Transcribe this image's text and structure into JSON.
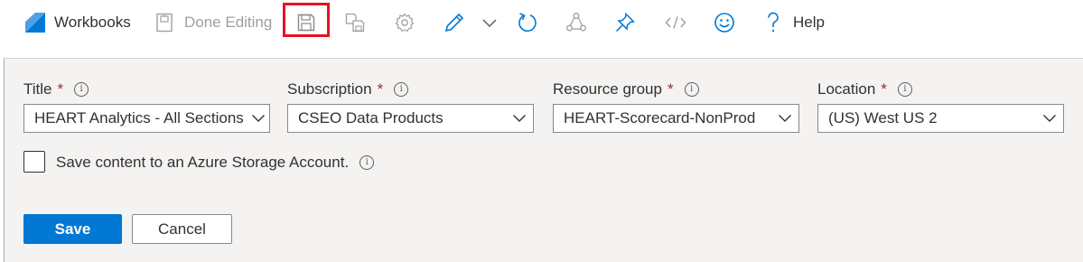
{
  "toolbar": {
    "workbooks_label": "Workbooks",
    "done_editing_label": "Done Editing",
    "help_label": "Help",
    "icons": [
      "workbooks-logo-icon",
      "done-editing-icon",
      "save-icon",
      "save-as-icon",
      "settings-icon",
      "edit-icon",
      "chevron-down-icon",
      "refresh-icon",
      "share-icon",
      "pin-icon",
      "code-icon",
      "feedback-smile-icon",
      "help-icon"
    ]
  },
  "form": {
    "title_label": "Title",
    "title_value": "HEART Analytics - All Sections",
    "subscription_label": "Subscription",
    "subscription_value": "CSEO Data Products",
    "resource_group_label": "Resource group",
    "resource_group_value": "HEART-Scorecard-NonProd",
    "location_label": "Location",
    "location_value": "(US) West US 2",
    "required_marker": "*",
    "info_glyph": "i",
    "storage_checkbox_label": "Save content to an Azure Storage Account.",
    "storage_checked": false
  },
  "actions": {
    "save_label": "Save",
    "cancel_label": "Cancel"
  },
  "colors": {
    "accent": "#0078d4",
    "highlight": "#e81123",
    "required": "#a4262c",
    "panel_bg": "#f4f3f2"
  }
}
